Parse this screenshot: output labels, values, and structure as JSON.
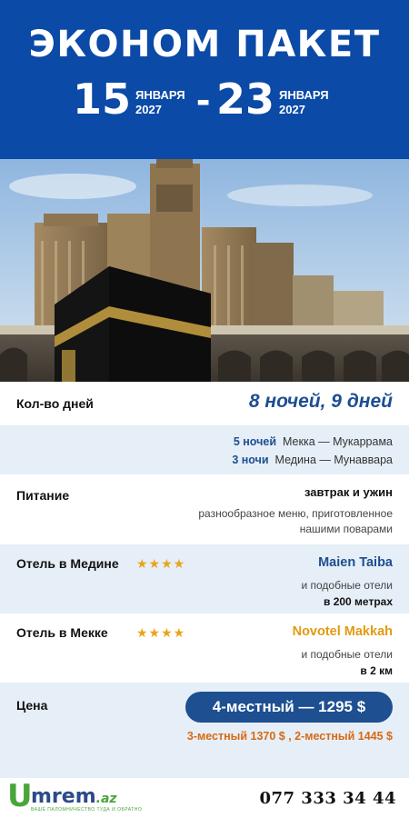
{
  "header": {
    "title": "ЭКОНОМ ПАКЕТ",
    "start_day": "15",
    "start_month": "ЯНВАРЯ",
    "start_year": "2027",
    "separator": "-",
    "end_day": "23",
    "end_month": "ЯНВАРЯ",
    "end_year": "2027"
  },
  "photo": {
    "icon": "kaaba-mecca-photo"
  },
  "days": {
    "label": "Кол-во дней",
    "value": "8 ночей, 9 дней"
  },
  "nights": [
    {
      "count": "5 ночей",
      "place": "Мекка — Мукаррама"
    },
    {
      "count": "3 ночи",
      "place": "Медина — Мунаввара"
    }
  ],
  "food": {
    "label": "Питание",
    "value": "завтрак и ужин",
    "note": "разнообразное меню, приготовленное нашими поварами"
  },
  "medina_hotel": {
    "label": "Отель в Медине",
    "stars": "★★★★",
    "name": "Maien Taiba",
    "note": "и подобные отели",
    "distance": "в 200 метрах",
    "color": "#1d4f91"
  },
  "mecca_hotel": {
    "label": "Отель в Мекке",
    "stars": "★★★★",
    "name": "Novotel Makkah",
    "note": "и подобные отели",
    "distance": "в 2 км",
    "color": "#e29a12"
  },
  "price": {
    "label": "Цена",
    "main": "4-местный — 1295 $",
    "other": "3-местный 1370 $  ,  2-местный 1445 $"
  },
  "footer": {
    "logo_u": "U",
    "logo_rest": "mrem",
    "logo_tld": ".az",
    "logo_tagline": "ВАШЕ ПАЛОМНИЧЕСТВО ТУДА И ОБРАТНО",
    "phone": "077 333 34 44"
  },
  "colors": {
    "header_bg": "#0b4aa6",
    "accent_blue": "#1d4f91",
    "accent_orange": "#d86a13",
    "stripe_bg": "#e6eef7",
    "star": "#e9a41a",
    "logo_green": "#4aa53a"
  }
}
